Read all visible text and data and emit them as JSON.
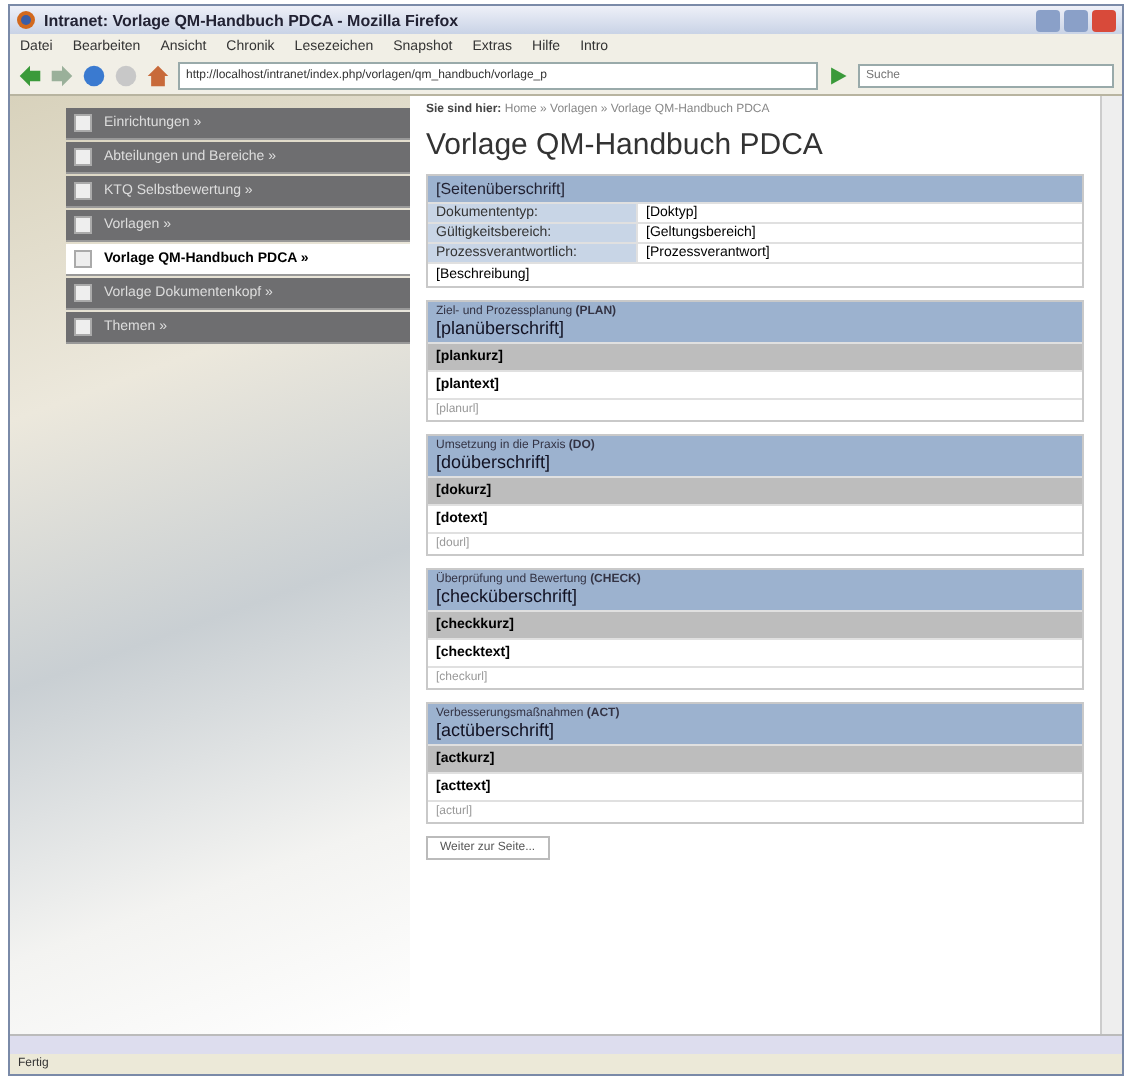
{
  "window": {
    "title": "Intranet: Vorlage QM-Handbuch PDCA - Mozilla Firefox"
  },
  "menu": [
    "Datei",
    "Bearbeiten",
    "Ansicht",
    "Chronik",
    "Lesezeichen",
    "Snapshot",
    "Extras",
    "Hilfe",
    "Intro"
  ],
  "toolbar": {
    "url": "http://localhost/intranet/index.php/vorlagen/qm_handbuch/vorlage_p",
    "search_placeholder": "Suche"
  },
  "sidebar": {
    "items": [
      {
        "label": "Einrichtungen »",
        "selected": false
      },
      {
        "label": "Abteilungen und Bereiche »",
        "selected": false
      },
      {
        "label": "KTQ Selbstbewertung »",
        "selected": false
      },
      {
        "label": "Vorlagen »",
        "selected": false
      },
      {
        "label": "Vorlage QM-Handbuch PDCA »",
        "selected": true
      },
      {
        "label": "Vorlage Dokumentenkopf »",
        "selected": false
      },
      {
        "label": "Themen »",
        "selected": false
      }
    ]
  },
  "breadcrumb": {
    "label": "Sie sind hier:",
    "path": "Home » Vorlagen » Vorlage QM-Handbuch PDCA"
  },
  "heading": "Vorlage QM-Handbuch PDCA",
  "info_table": {
    "header": "[Seitenüberschrift]",
    "rows": [
      {
        "label": "Dokumententyp:",
        "value": "[Doktyp]"
      },
      {
        "label": "Gültigkeitsbereich:",
        "value": "[Geltungsbereich]"
      },
      {
        "label": "Prozessverantwortlich:",
        "value": "[Prozessverantwort]"
      }
    ],
    "description": "[Beschreibung]"
  },
  "sections": [
    {
      "title": "Ziel- und Prozessplanung **(PLAN)**",
      "heading": "[planüberschrift]",
      "short": "[plankurz]",
      "text": "[plantext]",
      "url": "[planurl]"
    },
    {
      "title": "Umsetzung in die Praxis **(DO)**",
      "heading": "[doüberschrift]",
      "short": "[dokurz]",
      "text": "[dotext]",
      "url": "[dourl]"
    },
    {
      "title": "Überprüfung und Bewertung **(CHECK)**",
      "heading": "[checküberschrift]",
      "short": "[checkkurz]",
      "text": "[checktext]",
      "url": "[checkurl]"
    },
    {
      "title": "Verbesserungsmaßnahmen **(ACT)**",
      "heading": "[actüberschrift]",
      "short": "[actkurz]",
      "text": "[acttext]",
      "url": "[acturl]"
    }
  ],
  "button": "Weiter zur Seite...",
  "status_bar": {
    "text": "Fertig"
  }
}
